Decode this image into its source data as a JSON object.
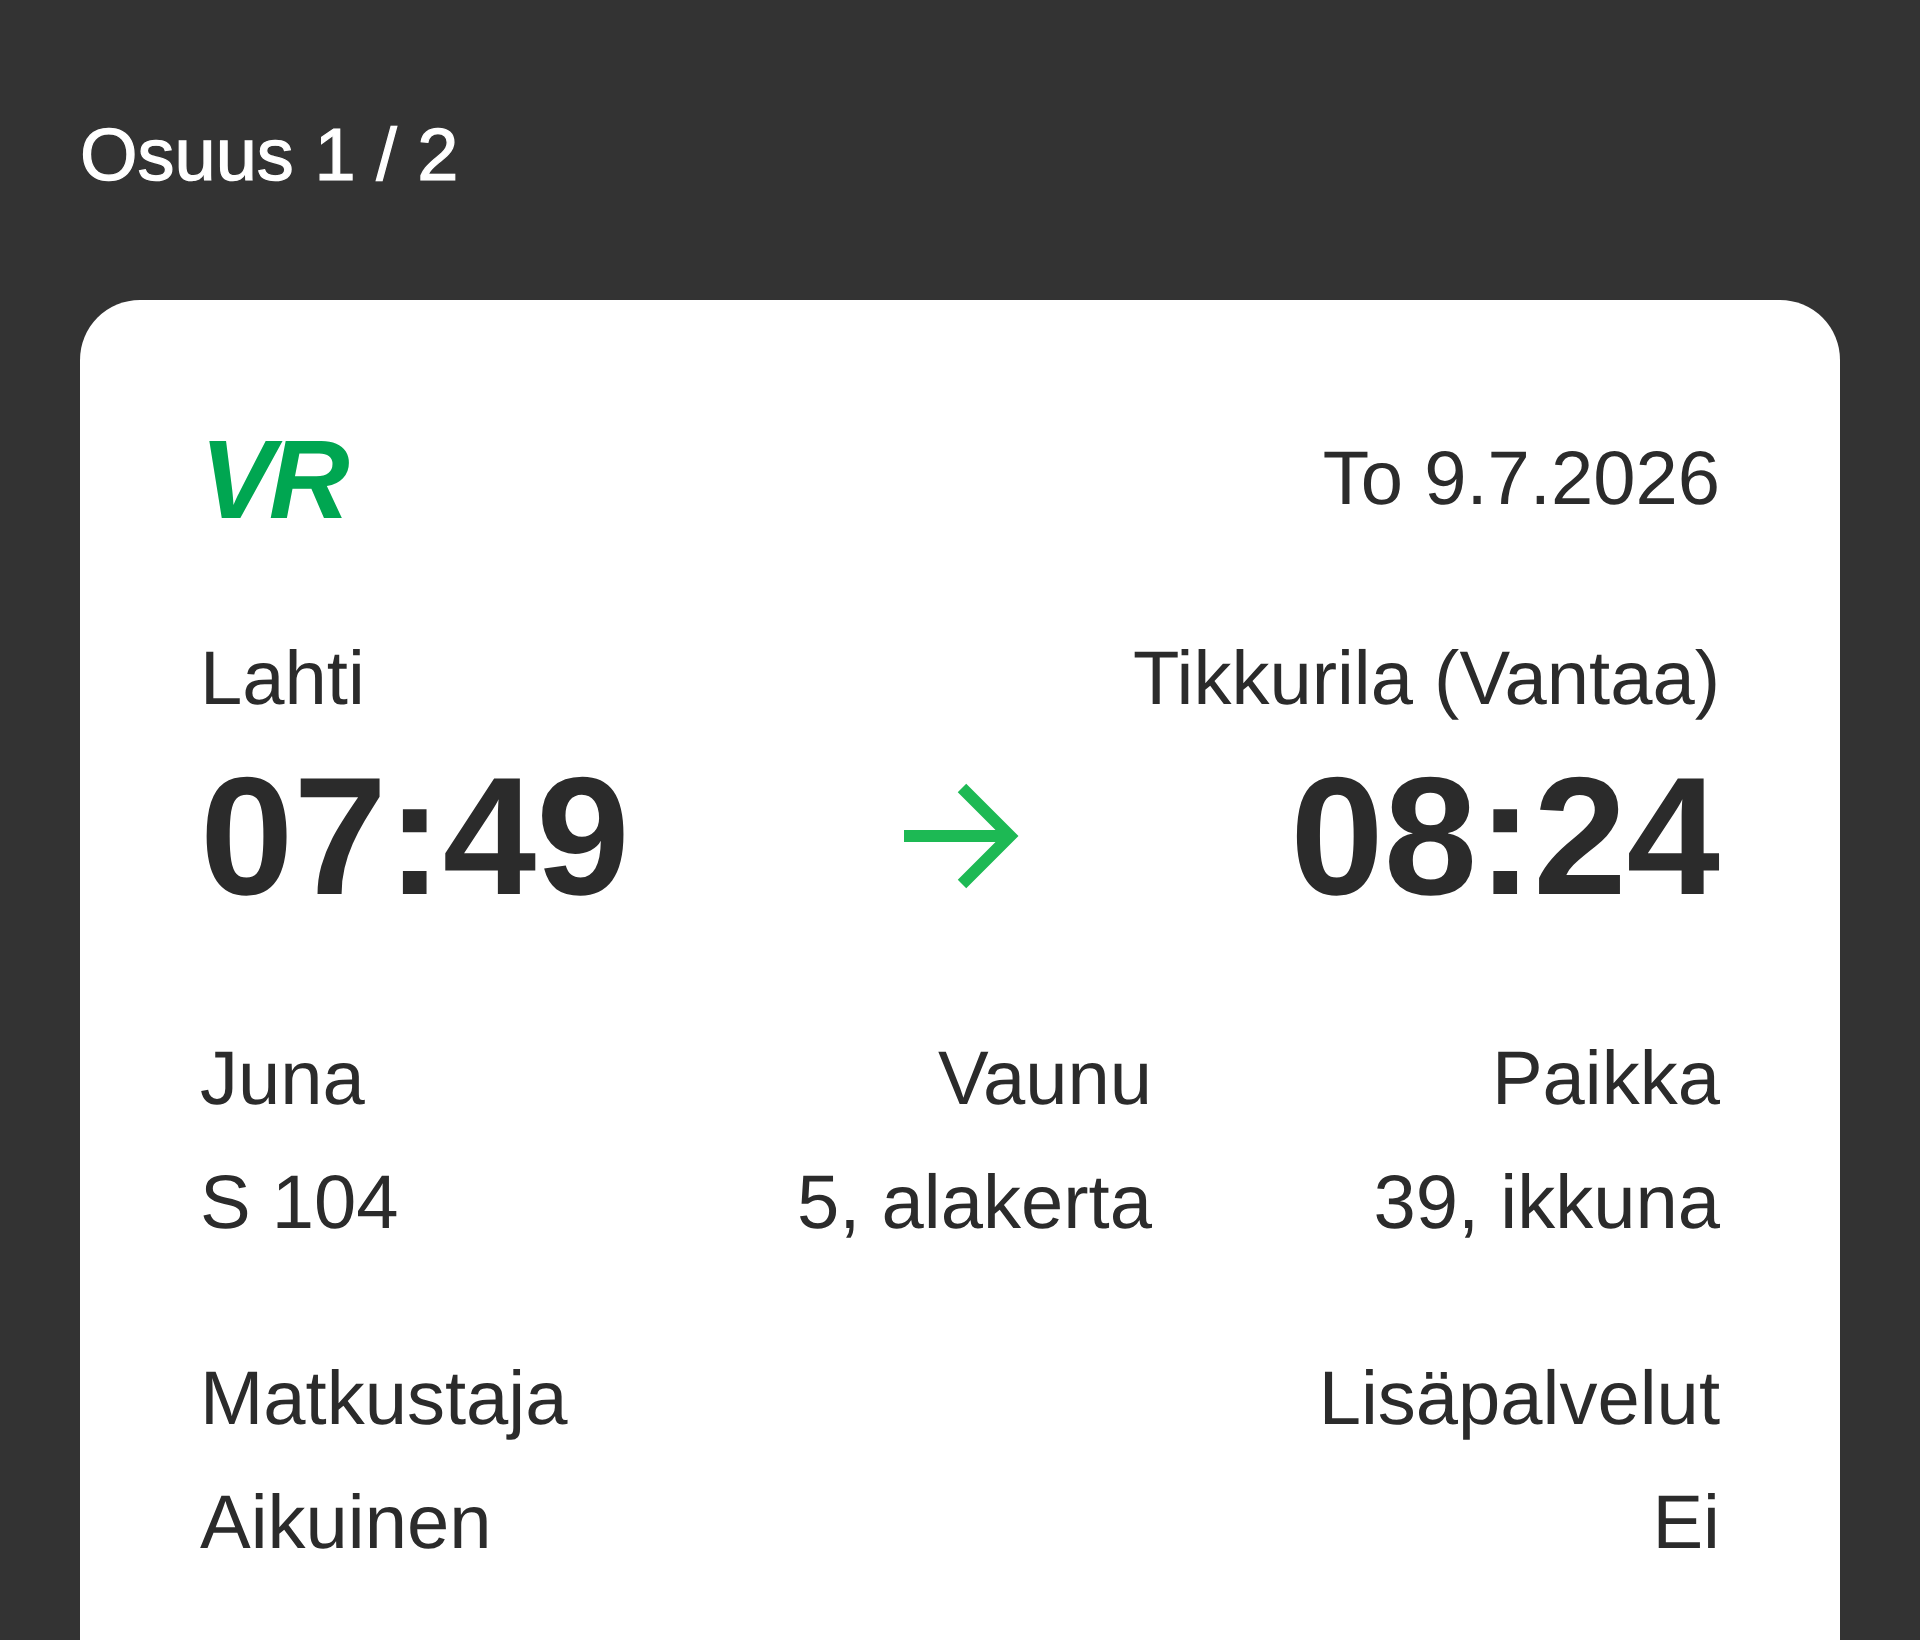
{
  "title": "Osuus 1 / 2",
  "ticket": {
    "logo": "VR",
    "date": "To 9.7.2026",
    "departure": {
      "station": "Lahti",
      "time": "07:49"
    },
    "arrival": {
      "station": "Tikkurila (Vantaa)",
      "time": "08:24"
    },
    "details": [
      {
        "label": "Juna",
        "value": "S 104"
      },
      {
        "label": "Vaunu",
        "value": "5, alakerta"
      },
      {
        "label": "Paikka",
        "value": "39, ikkuna"
      }
    ],
    "passenger": [
      {
        "label": "Matkustaja",
        "value": "Aikuinen"
      },
      {
        "label": "Lisäpalvelut",
        "value": "Ei"
      }
    ]
  }
}
